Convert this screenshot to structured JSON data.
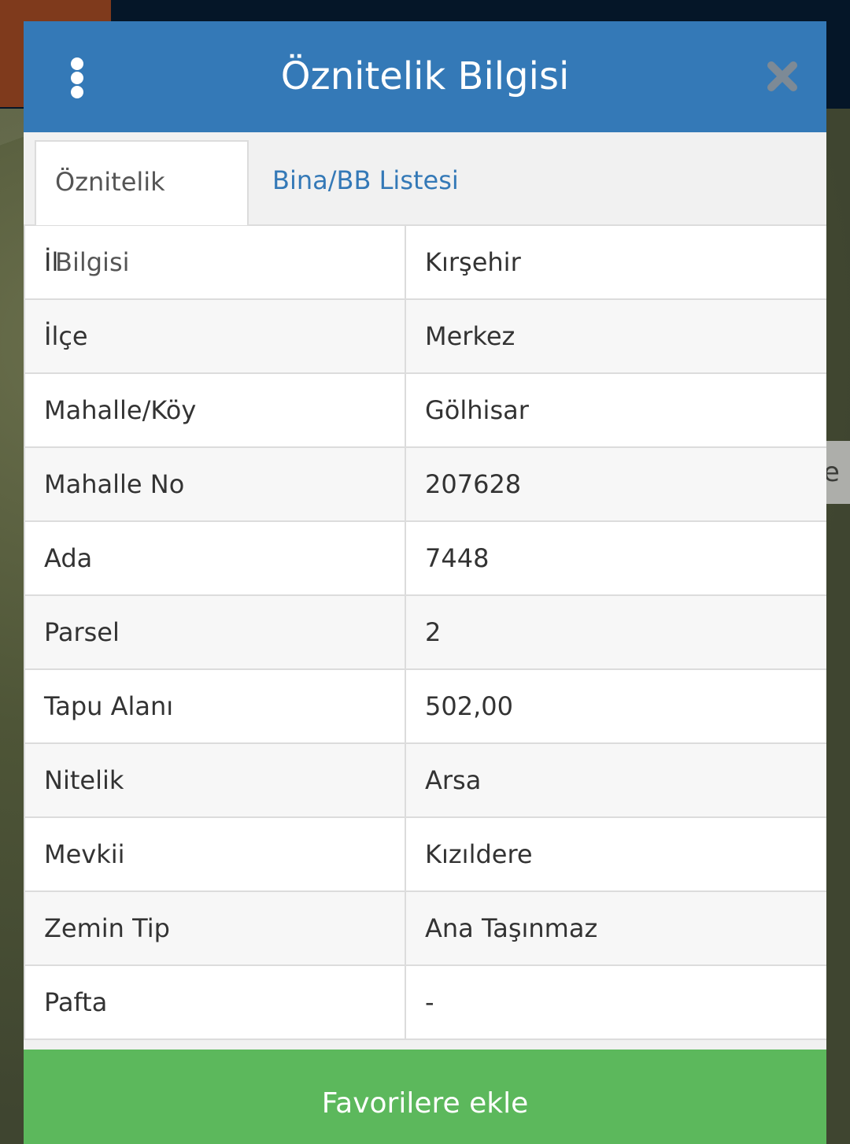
{
  "background": {
    "map_label_fragment": "e"
  },
  "dialog": {
    "title": "Öznitelik Bilgisi"
  },
  "tabs": [
    {
      "label": "Öznitelik Bilgisi",
      "active": true
    },
    {
      "label": "Bina/BB Listesi",
      "active": false
    }
  ],
  "attributes": [
    {
      "key": "İl",
      "value": "Kırşehir"
    },
    {
      "key": "İlçe",
      "value": "Merkez"
    },
    {
      "key": "Mahalle/Köy",
      "value": "Gölhisar"
    },
    {
      "key": "Mahalle No",
      "value": "207628"
    },
    {
      "key": "Ada",
      "value": "7448"
    },
    {
      "key": "Parsel",
      "value": "2"
    },
    {
      "key": "Tapu Alanı",
      "value": "502,00"
    },
    {
      "key": "Nitelik",
      "value": "Arsa"
    },
    {
      "key": "Mevkii",
      "value": "Kızıldere"
    },
    {
      "key": "Zemin Tip",
      "value": "Ana Taşınmaz"
    },
    {
      "key": "Pafta",
      "value": "-"
    }
  ],
  "footer": {
    "favorite_button_label": "Favorilere ekle"
  },
  "colors": {
    "header_blue": "#3479b7",
    "button_green": "#5cb85c",
    "close_icon_gray": "#7d8a96"
  },
  "icons": {
    "menu": "vertical-dots-icon",
    "close": "close-icon"
  }
}
